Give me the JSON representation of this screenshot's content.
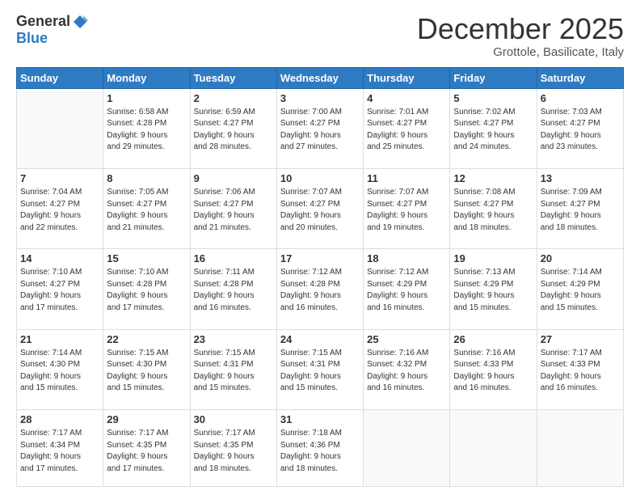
{
  "logo": {
    "general": "General",
    "blue": "Blue"
  },
  "header": {
    "month": "December 2025",
    "location": "Grottole, Basilicate, Italy"
  },
  "weekdays": [
    "Sunday",
    "Monday",
    "Tuesday",
    "Wednesday",
    "Thursday",
    "Friday",
    "Saturday"
  ],
  "weeks": [
    [
      {
        "day": "",
        "info": ""
      },
      {
        "day": "1",
        "info": "Sunrise: 6:58 AM\nSunset: 4:28 PM\nDaylight: 9 hours\nand 29 minutes."
      },
      {
        "day": "2",
        "info": "Sunrise: 6:59 AM\nSunset: 4:27 PM\nDaylight: 9 hours\nand 28 minutes."
      },
      {
        "day": "3",
        "info": "Sunrise: 7:00 AM\nSunset: 4:27 PM\nDaylight: 9 hours\nand 27 minutes."
      },
      {
        "day": "4",
        "info": "Sunrise: 7:01 AM\nSunset: 4:27 PM\nDaylight: 9 hours\nand 25 minutes."
      },
      {
        "day": "5",
        "info": "Sunrise: 7:02 AM\nSunset: 4:27 PM\nDaylight: 9 hours\nand 24 minutes."
      },
      {
        "day": "6",
        "info": "Sunrise: 7:03 AM\nSunset: 4:27 PM\nDaylight: 9 hours\nand 23 minutes."
      }
    ],
    [
      {
        "day": "7",
        "info": "Sunrise: 7:04 AM\nSunset: 4:27 PM\nDaylight: 9 hours\nand 22 minutes."
      },
      {
        "day": "8",
        "info": "Sunrise: 7:05 AM\nSunset: 4:27 PM\nDaylight: 9 hours\nand 21 minutes."
      },
      {
        "day": "9",
        "info": "Sunrise: 7:06 AM\nSunset: 4:27 PM\nDaylight: 9 hours\nand 21 minutes."
      },
      {
        "day": "10",
        "info": "Sunrise: 7:07 AM\nSunset: 4:27 PM\nDaylight: 9 hours\nand 20 minutes."
      },
      {
        "day": "11",
        "info": "Sunrise: 7:07 AM\nSunset: 4:27 PM\nDaylight: 9 hours\nand 19 minutes."
      },
      {
        "day": "12",
        "info": "Sunrise: 7:08 AM\nSunset: 4:27 PM\nDaylight: 9 hours\nand 18 minutes."
      },
      {
        "day": "13",
        "info": "Sunrise: 7:09 AM\nSunset: 4:27 PM\nDaylight: 9 hours\nand 18 minutes."
      }
    ],
    [
      {
        "day": "14",
        "info": "Sunrise: 7:10 AM\nSunset: 4:27 PM\nDaylight: 9 hours\nand 17 minutes."
      },
      {
        "day": "15",
        "info": "Sunrise: 7:10 AM\nSunset: 4:28 PM\nDaylight: 9 hours\nand 17 minutes."
      },
      {
        "day": "16",
        "info": "Sunrise: 7:11 AM\nSunset: 4:28 PM\nDaylight: 9 hours\nand 16 minutes."
      },
      {
        "day": "17",
        "info": "Sunrise: 7:12 AM\nSunset: 4:28 PM\nDaylight: 9 hours\nand 16 minutes."
      },
      {
        "day": "18",
        "info": "Sunrise: 7:12 AM\nSunset: 4:29 PM\nDaylight: 9 hours\nand 16 minutes."
      },
      {
        "day": "19",
        "info": "Sunrise: 7:13 AM\nSunset: 4:29 PM\nDaylight: 9 hours\nand 15 minutes."
      },
      {
        "day": "20",
        "info": "Sunrise: 7:14 AM\nSunset: 4:29 PM\nDaylight: 9 hours\nand 15 minutes."
      }
    ],
    [
      {
        "day": "21",
        "info": "Sunrise: 7:14 AM\nSunset: 4:30 PM\nDaylight: 9 hours\nand 15 minutes."
      },
      {
        "day": "22",
        "info": "Sunrise: 7:15 AM\nSunset: 4:30 PM\nDaylight: 9 hours\nand 15 minutes."
      },
      {
        "day": "23",
        "info": "Sunrise: 7:15 AM\nSunset: 4:31 PM\nDaylight: 9 hours\nand 15 minutes."
      },
      {
        "day": "24",
        "info": "Sunrise: 7:15 AM\nSunset: 4:31 PM\nDaylight: 9 hours\nand 15 minutes."
      },
      {
        "day": "25",
        "info": "Sunrise: 7:16 AM\nSunset: 4:32 PM\nDaylight: 9 hours\nand 16 minutes."
      },
      {
        "day": "26",
        "info": "Sunrise: 7:16 AM\nSunset: 4:33 PM\nDaylight: 9 hours\nand 16 minutes."
      },
      {
        "day": "27",
        "info": "Sunrise: 7:17 AM\nSunset: 4:33 PM\nDaylight: 9 hours\nand 16 minutes."
      }
    ],
    [
      {
        "day": "28",
        "info": "Sunrise: 7:17 AM\nSunset: 4:34 PM\nDaylight: 9 hours\nand 17 minutes."
      },
      {
        "day": "29",
        "info": "Sunrise: 7:17 AM\nSunset: 4:35 PM\nDaylight: 9 hours\nand 17 minutes."
      },
      {
        "day": "30",
        "info": "Sunrise: 7:17 AM\nSunset: 4:35 PM\nDaylight: 9 hours\nand 18 minutes."
      },
      {
        "day": "31",
        "info": "Sunrise: 7:18 AM\nSunset: 4:36 PM\nDaylight: 9 hours\nand 18 minutes."
      },
      {
        "day": "",
        "info": ""
      },
      {
        "day": "",
        "info": ""
      },
      {
        "day": "",
        "info": ""
      }
    ]
  ]
}
